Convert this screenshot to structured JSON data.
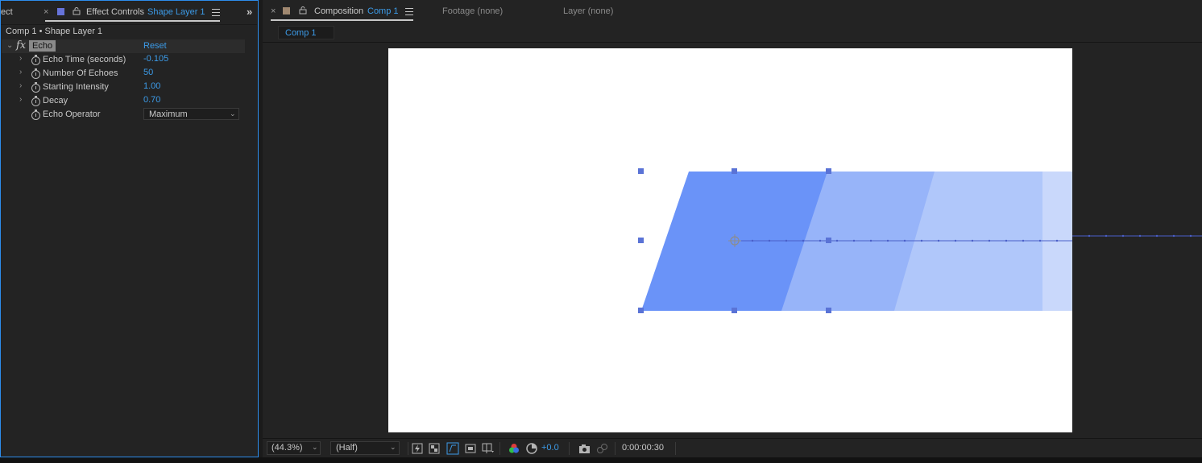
{
  "left_panel": {
    "tab_prev_partial": "ect",
    "tab_label": "Effect Controls",
    "tab_layer": "Shape Layer 1",
    "layer_swatch_color": "#6673d9",
    "breadcrumb": "Comp 1 • Shape Layer 1",
    "effect": {
      "fx_label": "fx",
      "name": "Echo",
      "reset_label": "Reset"
    },
    "properties": [
      {
        "label": "Echo Time (seconds)",
        "value": "-0.105"
      },
      {
        "label": "Number Of Echoes",
        "value": "50"
      },
      {
        "label": "Starting Intensity",
        "value": "1.00"
      },
      {
        "label": "Decay",
        "value": "0.70"
      }
    ],
    "operator": {
      "label": "Echo Operator",
      "value": "Maximum"
    }
  },
  "comp_panel": {
    "tab_label": "Composition",
    "tab_comp": "Comp 1",
    "comp_swatch_color": "#a08870",
    "footage_tab": "Footage (none)",
    "layer_tab": "Layer (none)",
    "subtab": "Comp 1"
  },
  "bottom_bar": {
    "zoom": "(44.3%)",
    "resolution": "(Half)",
    "exposure": "+0.0",
    "timecode": "0:00:00:30"
  },
  "colors": {
    "accent": "#3c9be8",
    "shape_fill": "#6a93f8",
    "handle": "#5a73d6"
  }
}
